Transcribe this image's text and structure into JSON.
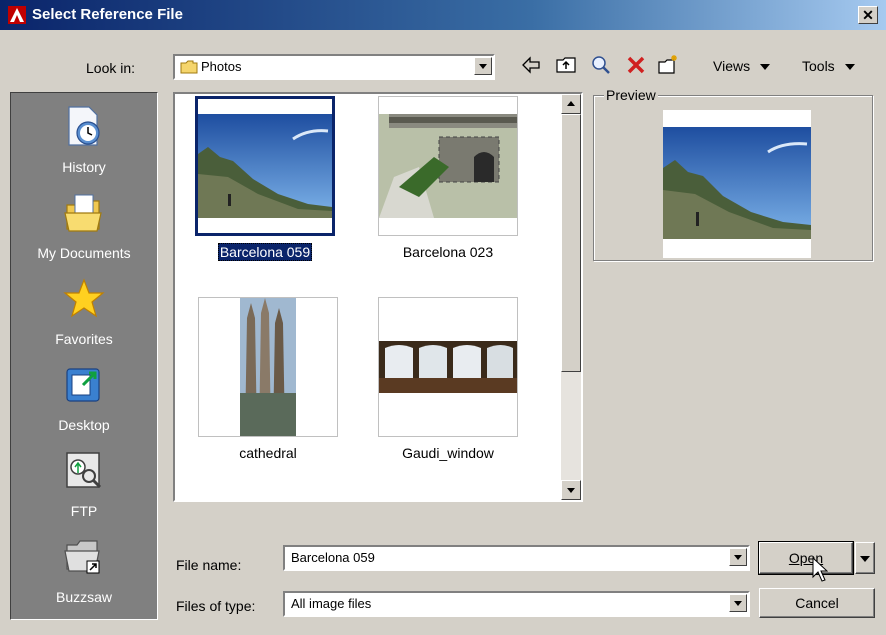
{
  "window": {
    "title": "Select Reference File",
    "close_label": "✕"
  },
  "look_in": {
    "label": "Look in:",
    "value": "Photos"
  },
  "toolbar": {
    "views_label": "Views",
    "tools_label": "Tools"
  },
  "places": [
    {
      "label": "History",
      "icon": "history-icon"
    },
    {
      "label": "My Documents",
      "icon": "my-documents-icon"
    },
    {
      "label": "Favorites",
      "icon": "favorites-icon"
    },
    {
      "label": "Desktop",
      "icon": "desktop-icon"
    },
    {
      "label": "FTP",
      "icon": "ftp-icon"
    },
    {
      "label": "Buzzsaw",
      "icon": "buzzsaw-icon"
    }
  ],
  "files": [
    {
      "name": "Barcelona 059",
      "selected": true
    },
    {
      "name": "Barcelona 023",
      "selected": false
    },
    {
      "name": "cathedral",
      "selected": false
    },
    {
      "name": "Gaudi_window",
      "selected": false
    }
  ],
  "preview": {
    "label": "Preview"
  },
  "file_name": {
    "label": "File name:",
    "value": "Barcelona 059"
  },
  "file_type": {
    "label": "Files of type:",
    "value": "All image files"
  },
  "buttons": {
    "open": "Open",
    "cancel": "Cancel"
  }
}
